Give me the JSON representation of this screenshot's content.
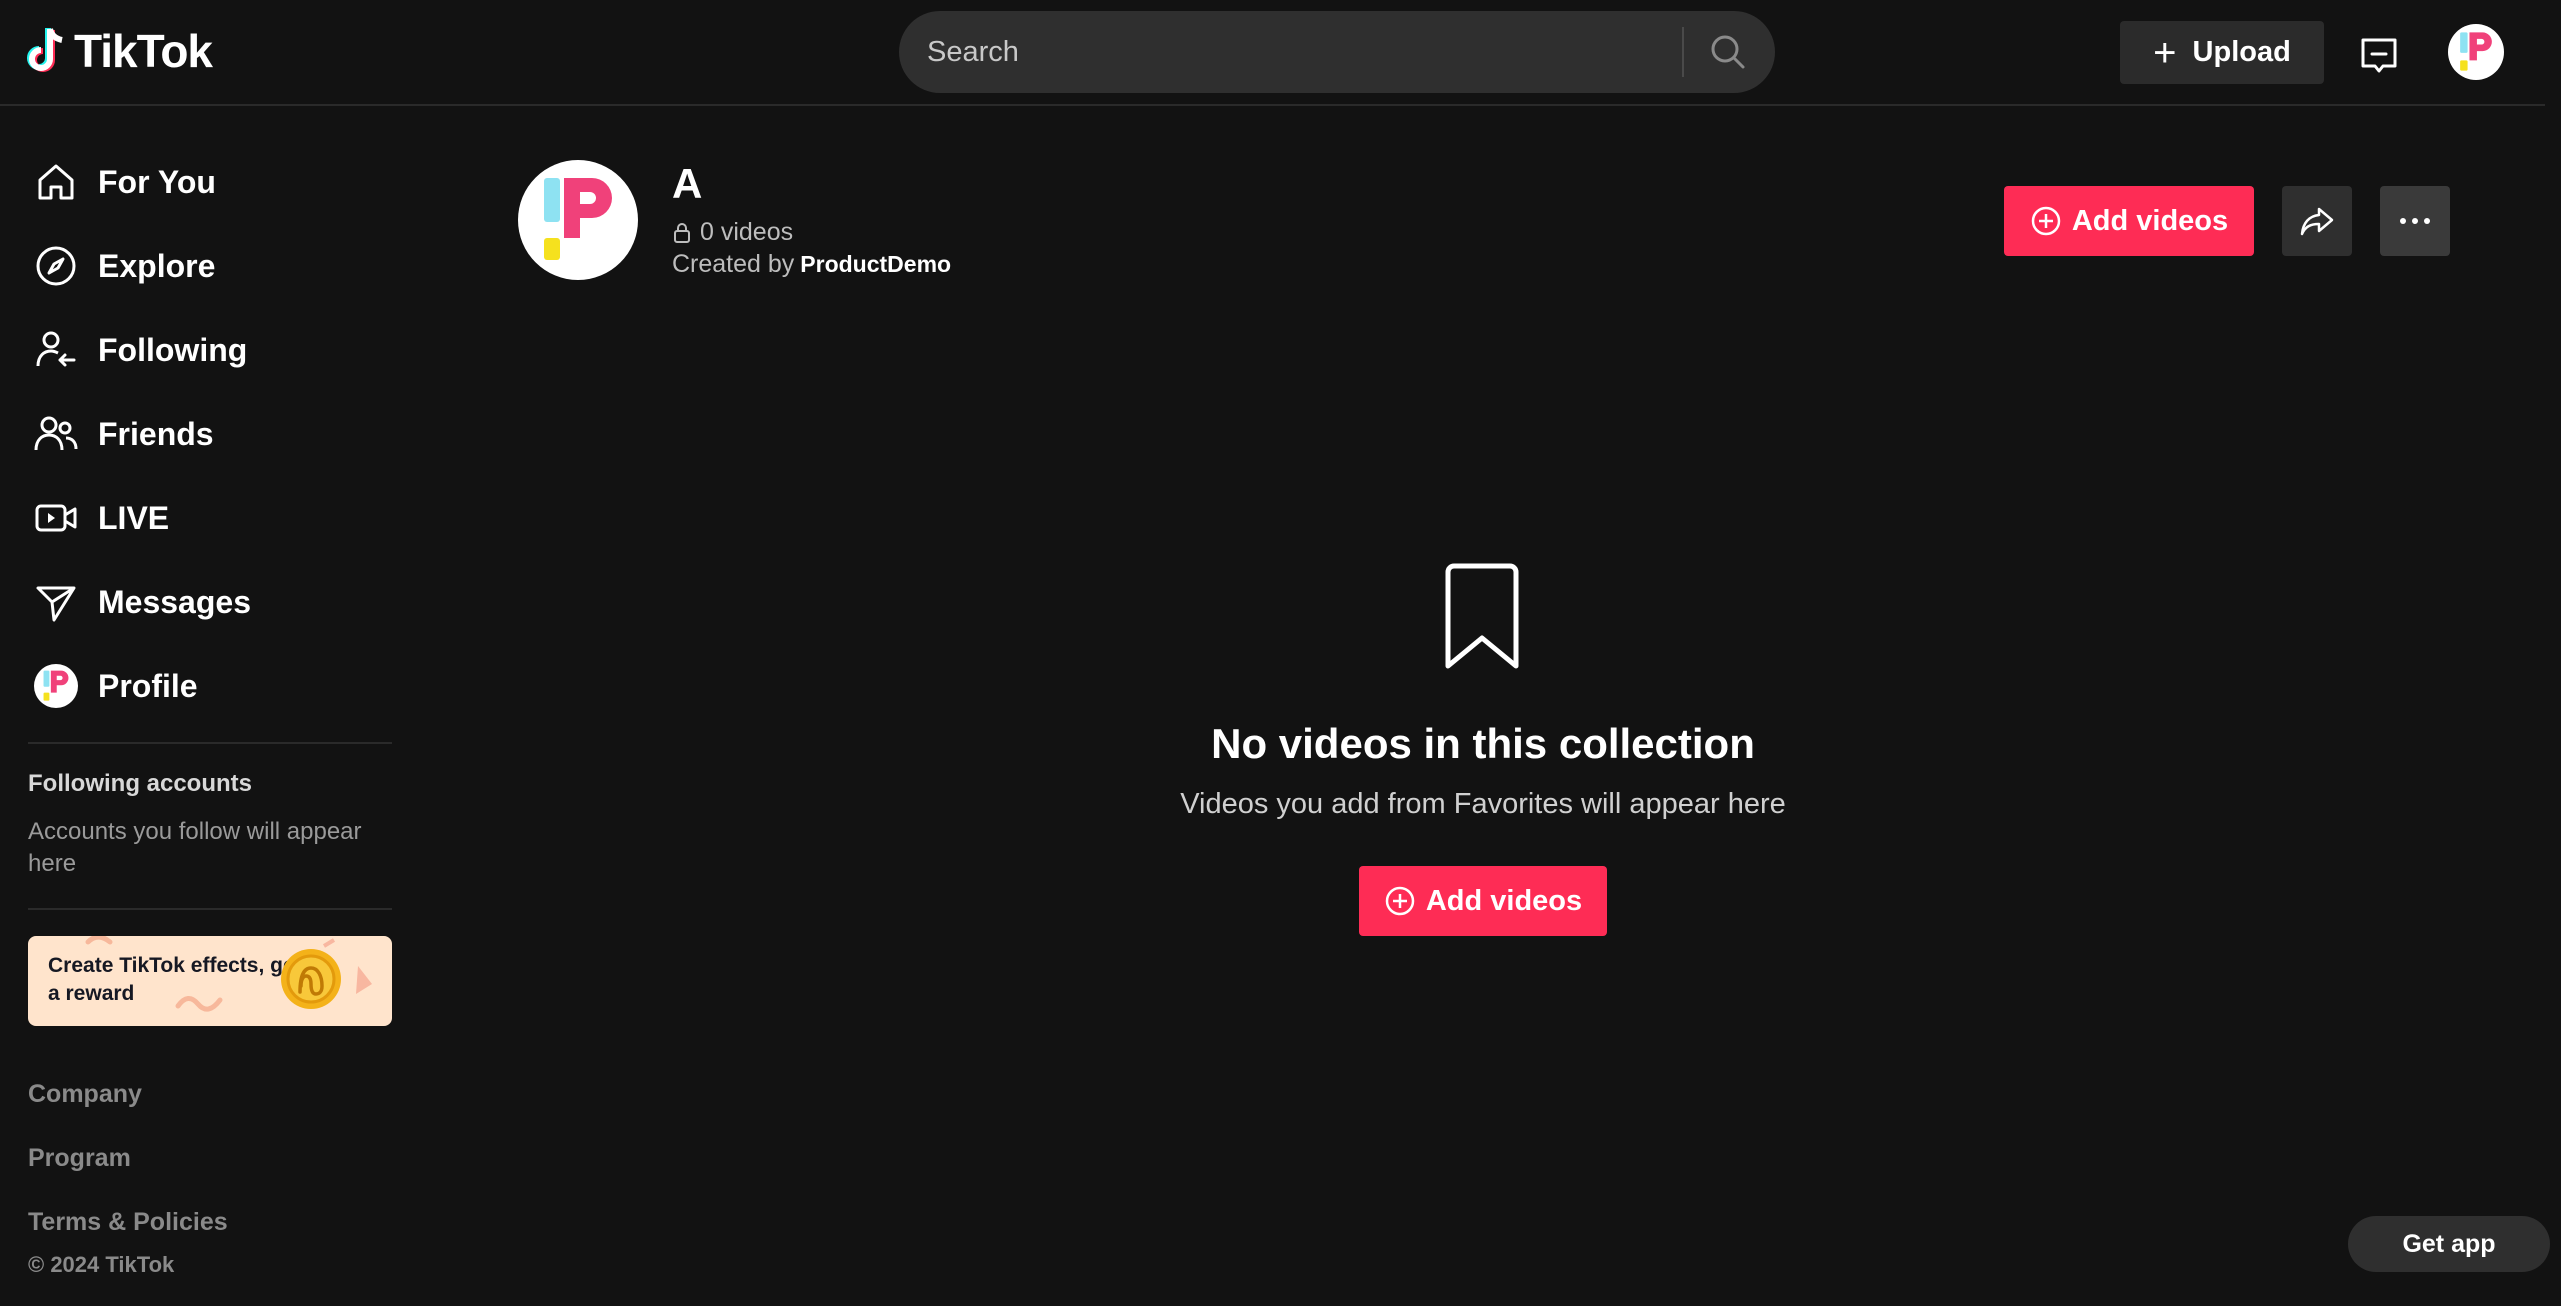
{
  "header": {
    "logo_text": "TikTok",
    "search_placeholder": "Search",
    "upload_label": "Upload"
  },
  "sidebar": {
    "items": [
      {
        "label": "For You",
        "icon": "home-icon"
      },
      {
        "label": "Explore",
        "icon": "compass-icon"
      },
      {
        "label": "Following",
        "icon": "following-user-icon"
      },
      {
        "label": "Friends",
        "icon": "friends-icon"
      },
      {
        "label": "LIVE",
        "icon": "live-camera-icon"
      },
      {
        "label": "Messages",
        "icon": "paper-plane-icon"
      },
      {
        "label": "Profile",
        "icon": "avatar"
      }
    ],
    "following_title": "Following accounts",
    "following_desc": "Accounts you follow will appear here",
    "promo_text": "Create TikTok effects, get a reward",
    "footer_links": [
      "Company",
      "Program",
      "Terms & Policies"
    ],
    "copyright": "© 2024 TikTok"
  },
  "collection": {
    "title": "A",
    "video_count": "0 videos",
    "created_by_prefix": "Created by",
    "creator": "ProductDemo",
    "add_videos_label": "Add videos"
  },
  "empty_state": {
    "title": "No videos in this collection",
    "description": "Videos you add from Favorites will appear here",
    "add_videos_label": "Add videos"
  },
  "get_app_label": "Get app",
  "colors": {
    "background": "#121212",
    "accent": "#fe2c55",
    "button_dark": "#2f2f2f"
  }
}
